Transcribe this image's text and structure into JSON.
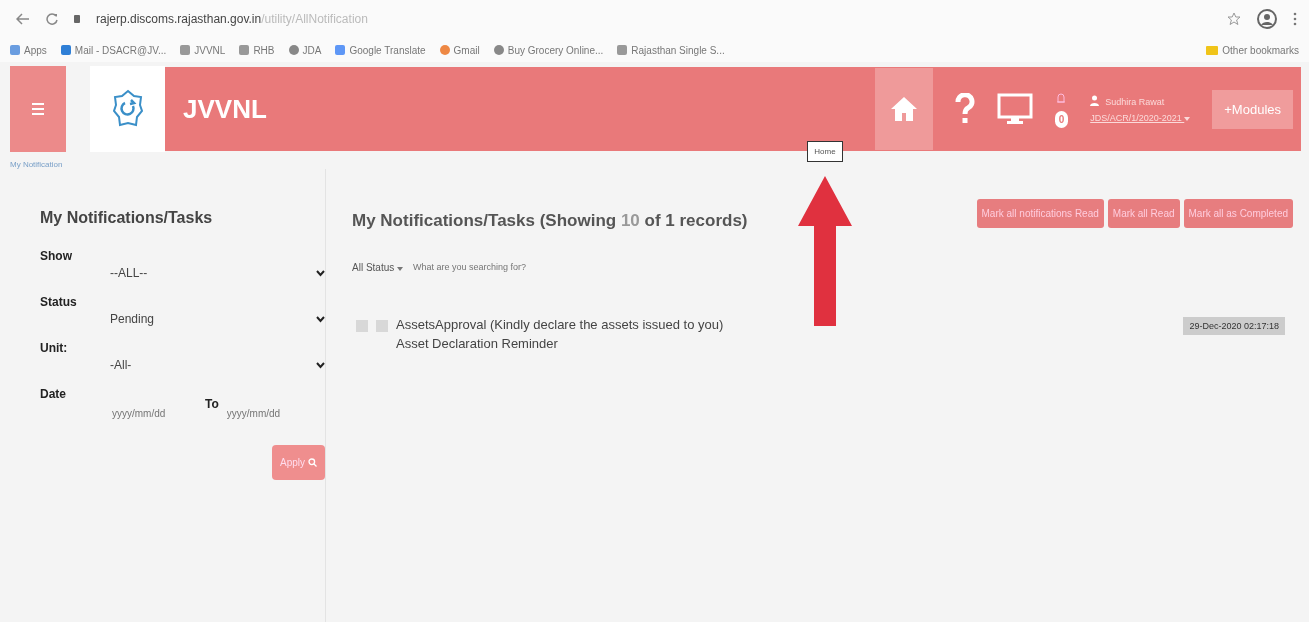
{
  "browser": {
    "url_host": "rajerp.discoms.rajasthan.gov.in",
    "url_path": "/utility/AllNotification",
    "bookmarks": [
      {
        "label": "Apps",
        "kind": "apps"
      },
      {
        "label": "Mail - DSACR@JV...",
        "kind": "mail"
      },
      {
        "label": "JVVNL",
        "kind": "site"
      },
      {
        "label": "RHB",
        "kind": "site"
      },
      {
        "label": "JDA",
        "kind": "globe"
      },
      {
        "label": "Google Translate",
        "kind": "doc"
      },
      {
        "label": "Gmail",
        "kind": "g"
      },
      {
        "label": "Buy Grocery Online...",
        "kind": "globe"
      },
      {
        "label": "Rajasthan Single S...",
        "kind": "site"
      }
    ],
    "other_bookmarks": "Other bookmarks"
  },
  "header": {
    "brand": "JVVNL",
    "logo_caption": "My Notification",
    "notification_count": "0",
    "user_name": "Sudhira Rawat",
    "user_role": "JDS/ACR/1/2020-2021",
    "modules_button": "+Modules",
    "tooltip": "Home"
  },
  "filters": {
    "title": "My Notifications/Tasks",
    "fields": [
      {
        "label": "Show",
        "value": "--ALL--",
        "kind": "select"
      },
      {
        "label": "Status",
        "value": "Pending",
        "kind": "select"
      },
      {
        "label": "Unit:",
        "value": "-All-",
        "kind": "select"
      },
      {
        "label": "Date",
        "kind": "daterange",
        "placeholder": "yyyy/mm/dd",
        "to_label": "To",
        "to_placeholder": "yyyy/mm/dd"
      }
    ],
    "apply_button": "Apply"
  },
  "main": {
    "title_prefix": "My Notifications/Tasks (Showing ",
    "shown": "10",
    "title_suffix": " of 1 records)",
    "status_filter": "All Status",
    "search": {
      "placeholder": "What are you searching for?"
    },
    "actions": [
      "Mark all notifications Read",
      "Mark all Read",
      "Mark all as Completed"
    ],
    "items": [
      {
        "title": "AssetsApproval (Kindly declare the assets issued to you)",
        "subtitle": "Asset Declaration Reminder",
        "date": "29-Dec-2020 02:17:18"
      }
    ]
  }
}
